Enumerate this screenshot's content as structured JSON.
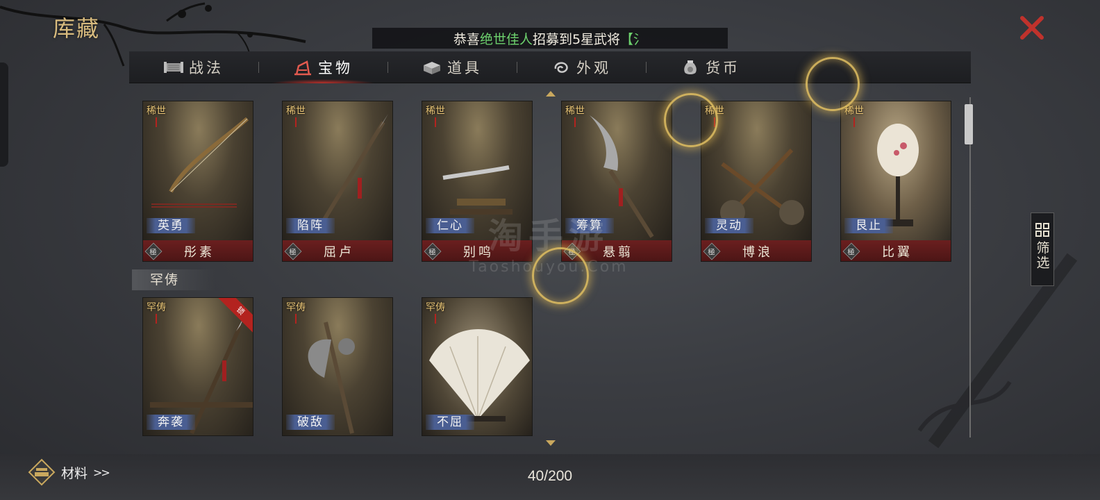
{
  "header": {
    "title": "库藏",
    "ticker": {
      "prefix": "恭喜",
      "highlight": "绝世佳人",
      "suffix": "招募到5星武将",
      "bracket": "【氵"
    }
  },
  "tabs": [
    {
      "label": "战法",
      "icon": "scroll-icon",
      "active": false
    },
    {
      "label": "宝物",
      "icon": "treasure-icon",
      "active": true
    },
    {
      "label": "道具",
      "icon": "box-icon",
      "active": false
    },
    {
      "label": "外观",
      "icon": "swirl-icon",
      "active": false
    },
    {
      "label": "货币",
      "icon": "coin-bag-icon",
      "active": false
    }
  ],
  "rare_row": [
    {
      "rarity": "稀世",
      "name": "英勇",
      "sub": "彤素",
      "grade": "極",
      "art": "bow"
    },
    {
      "rarity": "稀世",
      "name": "陷阵",
      "sub": "屈卢",
      "grade": "極",
      "art": "spear"
    },
    {
      "rarity": "稀世",
      "name": "仁心",
      "sub": "别鸣",
      "grade": "極",
      "art": "sword"
    },
    {
      "rarity": "稀世",
      "name": "筹算",
      "sub": "悬翦",
      "grade": "極",
      "art": "glaive"
    },
    {
      "rarity": "稀世",
      "name": "灵动",
      "sub": "博浪",
      "grade": "極",
      "art": "hammer"
    },
    {
      "rarity": "稀世",
      "name": "艮止",
      "sub": "比翼",
      "grade": "極",
      "art": "fan-round"
    }
  ],
  "section": {
    "label": "罕俦"
  },
  "uncommon_row": [
    {
      "rarity": "罕俦",
      "name": "奔袭",
      "art": "spear",
      "ribbon": "锁"
    },
    {
      "rarity": "罕俦",
      "name": "破敌",
      "art": "axe"
    },
    {
      "rarity": "罕俦",
      "name": "不屈",
      "art": "feather-fan"
    }
  ],
  "filter": {
    "label": "筛选"
  },
  "footer": {
    "materials_label": "材料",
    "materials_arrow": ">>",
    "count": "40/200"
  },
  "watermark": {
    "big": "淘手游",
    "small": "Taoshouyou.Com"
  },
  "colors": {
    "accent_gold": "#d8bb7e",
    "close_red": "#c0322c",
    "tag_blue": "#4a5e92",
    "ticker_green": "#6dd16d"
  }
}
